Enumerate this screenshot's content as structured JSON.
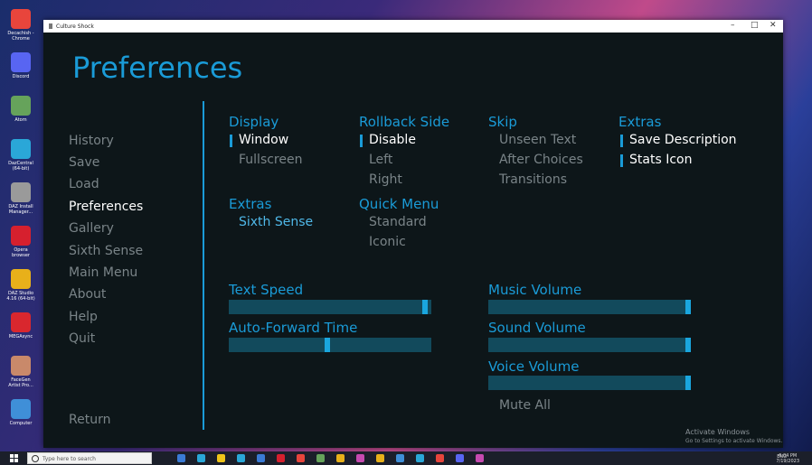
{
  "desktop": {
    "icons": [
      {
        "label": "Decachish -\nChrome",
        "side": "W",
        "color": "#e8453c"
      },
      {
        "label": "Discord",
        "side": "D",
        "color": "#5865f2"
      },
      {
        "label": "Atom",
        "side": "",
        "color": "#66a35b"
      },
      {
        "label": "DazCentral\n(64-bit)",
        "side": "R",
        "color": "#2aa7d8"
      },
      {
        "label": "DAZ Install\nManager...",
        "side": "R",
        "color": "#9a9a9a"
      },
      {
        "label": "Opera\nbrowser",
        "side": "",
        "color": "#d6202e"
      },
      {
        "label": "DAZ Studio\n4.16 (64-bit)",
        "side": "R",
        "color": "#e8b01a"
      },
      {
        "label": "MEGAsync",
        "side": "Fi",
        "color": "#d9272e"
      },
      {
        "label": "FaceGen\nArtist Pro...",
        "side": "",
        "color": "#c9896a"
      },
      {
        "label": "Computer",
        "side": "",
        "color": "#3f8fd8"
      }
    ]
  },
  "window": {
    "title": "Culture Shock",
    "controls": [
      "–",
      "□",
      "✕"
    ]
  },
  "screen": {
    "title": "Preferences",
    "nav": [
      {
        "label": "History"
      },
      {
        "label": "Save"
      },
      {
        "label": "Load"
      },
      {
        "label": "Preferences",
        "active": true
      },
      {
        "label": "Gallery"
      },
      {
        "label": "Sixth Sense"
      },
      {
        "label": "Main Menu"
      },
      {
        "label": "About"
      },
      {
        "label": "Help"
      },
      {
        "label": "Quit"
      }
    ],
    "return_label": "Return",
    "groups": {
      "display": {
        "header": "Display",
        "options": [
          "Window",
          "Fullscreen"
        ],
        "selected": "Window"
      },
      "rollback": {
        "header": "Rollback Side",
        "options": [
          "Disable",
          "Left",
          "Right"
        ],
        "selected": "Disable"
      },
      "skip": {
        "header": "Skip",
        "options": [
          "Unseen Text",
          "After Choices",
          "Transitions"
        ],
        "selected": ""
      },
      "extras_right": {
        "header": "Extras",
        "options": [
          "Save Description",
          "Stats Icon"
        ],
        "selected": [
          "Save Description",
          "Stats Icon"
        ]
      },
      "extras_left": {
        "header": "Extras",
        "options": [
          "Sixth Sense"
        ]
      },
      "quick_menu": {
        "header": "Quick Menu",
        "options": [
          "Standard",
          "Iconic"
        ],
        "selected": ""
      }
    },
    "sliders": {
      "text_speed": {
        "label": "Text Speed",
        "value": 0.98
      },
      "auto_forward": {
        "label": "Auto-Forward Time",
        "value": 0.5
      },
      "music_volume": {
        "label": "Music Volume",
        "value": 1.0
      },
      "sound_volume": {
        "label": "Sound Volume",
        "value": 1.0
      },
      "voice_volume": {
        "label": "Voice Volume",
        "value": 1.0
      }
    },
    "mute_all": "Mute All",
    "activation": {
      "line1": "Activate Windows",
      "line2": "Go to Settings to activate Windows."
    }
  },
  "taskbar": {
    "search_placeholder": "Type here to search",
    "tray_text": "ENG",
    "time": "6:04 PM",
    "date": "7/19/2023",
    "app_colors": [
      "#3a7bd5",
      "#2aa7d8",
      "#f0c419",
      "#2aa7d8",
      "#3a7bd5",
      "#d6202e",
      "#e8453c",
      "#66a35b",
      "#e8b01a",
      "#c64ab0",
      "#e8b01a",
      "#3f8fd8",
      "#2aa7d8",
      "#e8453c",
      "#5865f2",
      "#c64ab0"
    ]
  }
}
